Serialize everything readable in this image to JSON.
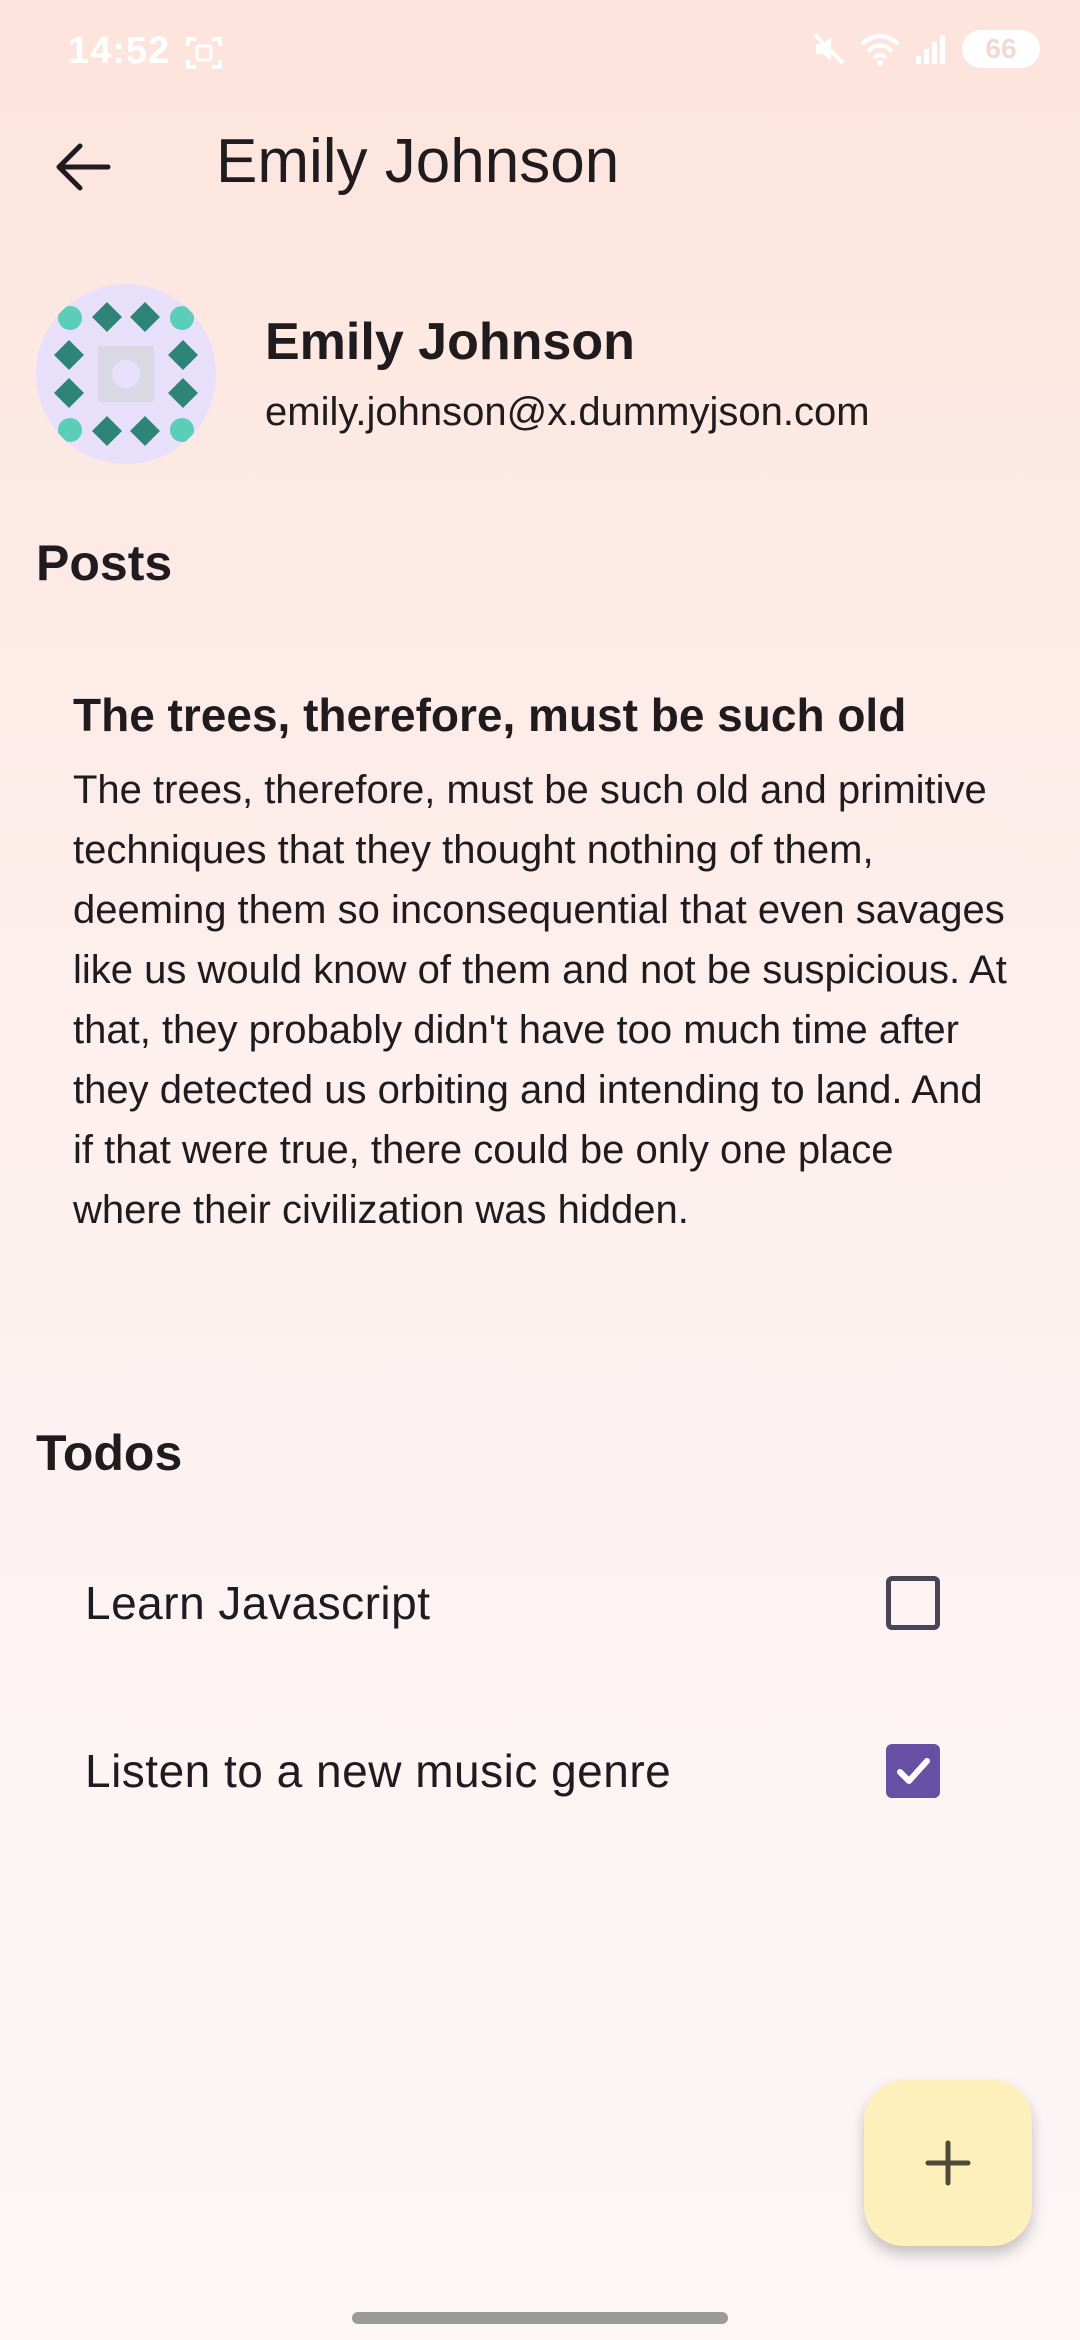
{
  "status_bar": {
    "time": "14:52",
    "battery": "66",
    "icons": [
      "screen-record-icon",
      "mute-icon",
      "wifi-icon",
      "signal-icon",
      "battery-icon"
    ]
  },
  "app_bar": {
    "title": "Emily Johnson",
    "back_icon": "arrow-back-icon"
  },
  "profile": {
    "name": "Emily Johnson",
    "email": "emily.johnson@x.dummyjson.com",
    "avatar": "identicon-avatar"
  },
  "posts": {
    "heading": "Posts",
    "items": [
      {
        "title": "The trees, therefore, must be such old",
        "body": "The trees, therefore, must be such old and primitive techniques that they thought nothing of them, deeming them so inconsequential that even savages like us would know of them and not be suspicious. At that, they probably didn't have too much time after they detected us orbiting and intending to land. And if that were true, there could be only one place where their civilization was hidden."
      }
    ]
  },
  "todos": {
    "heading": "Todos",
    "items": [
      {
        "label": "Learn Javascript",
        "completed": false
      },
      {
        "label": "Listen to a new music genre",
        "completed": true
      }
    ]
  },
  "fab": {
    "icon": "plus-icon"
  },
  "colors": {
    "accent": "#6750a4",
    "fab_bg": "#fef0ba",
    "avatar_bg": "#e8e0fb",
    "avatar_dark": "#2e8577",
    "avatar_light": "#5ccdb8"
  }
}
